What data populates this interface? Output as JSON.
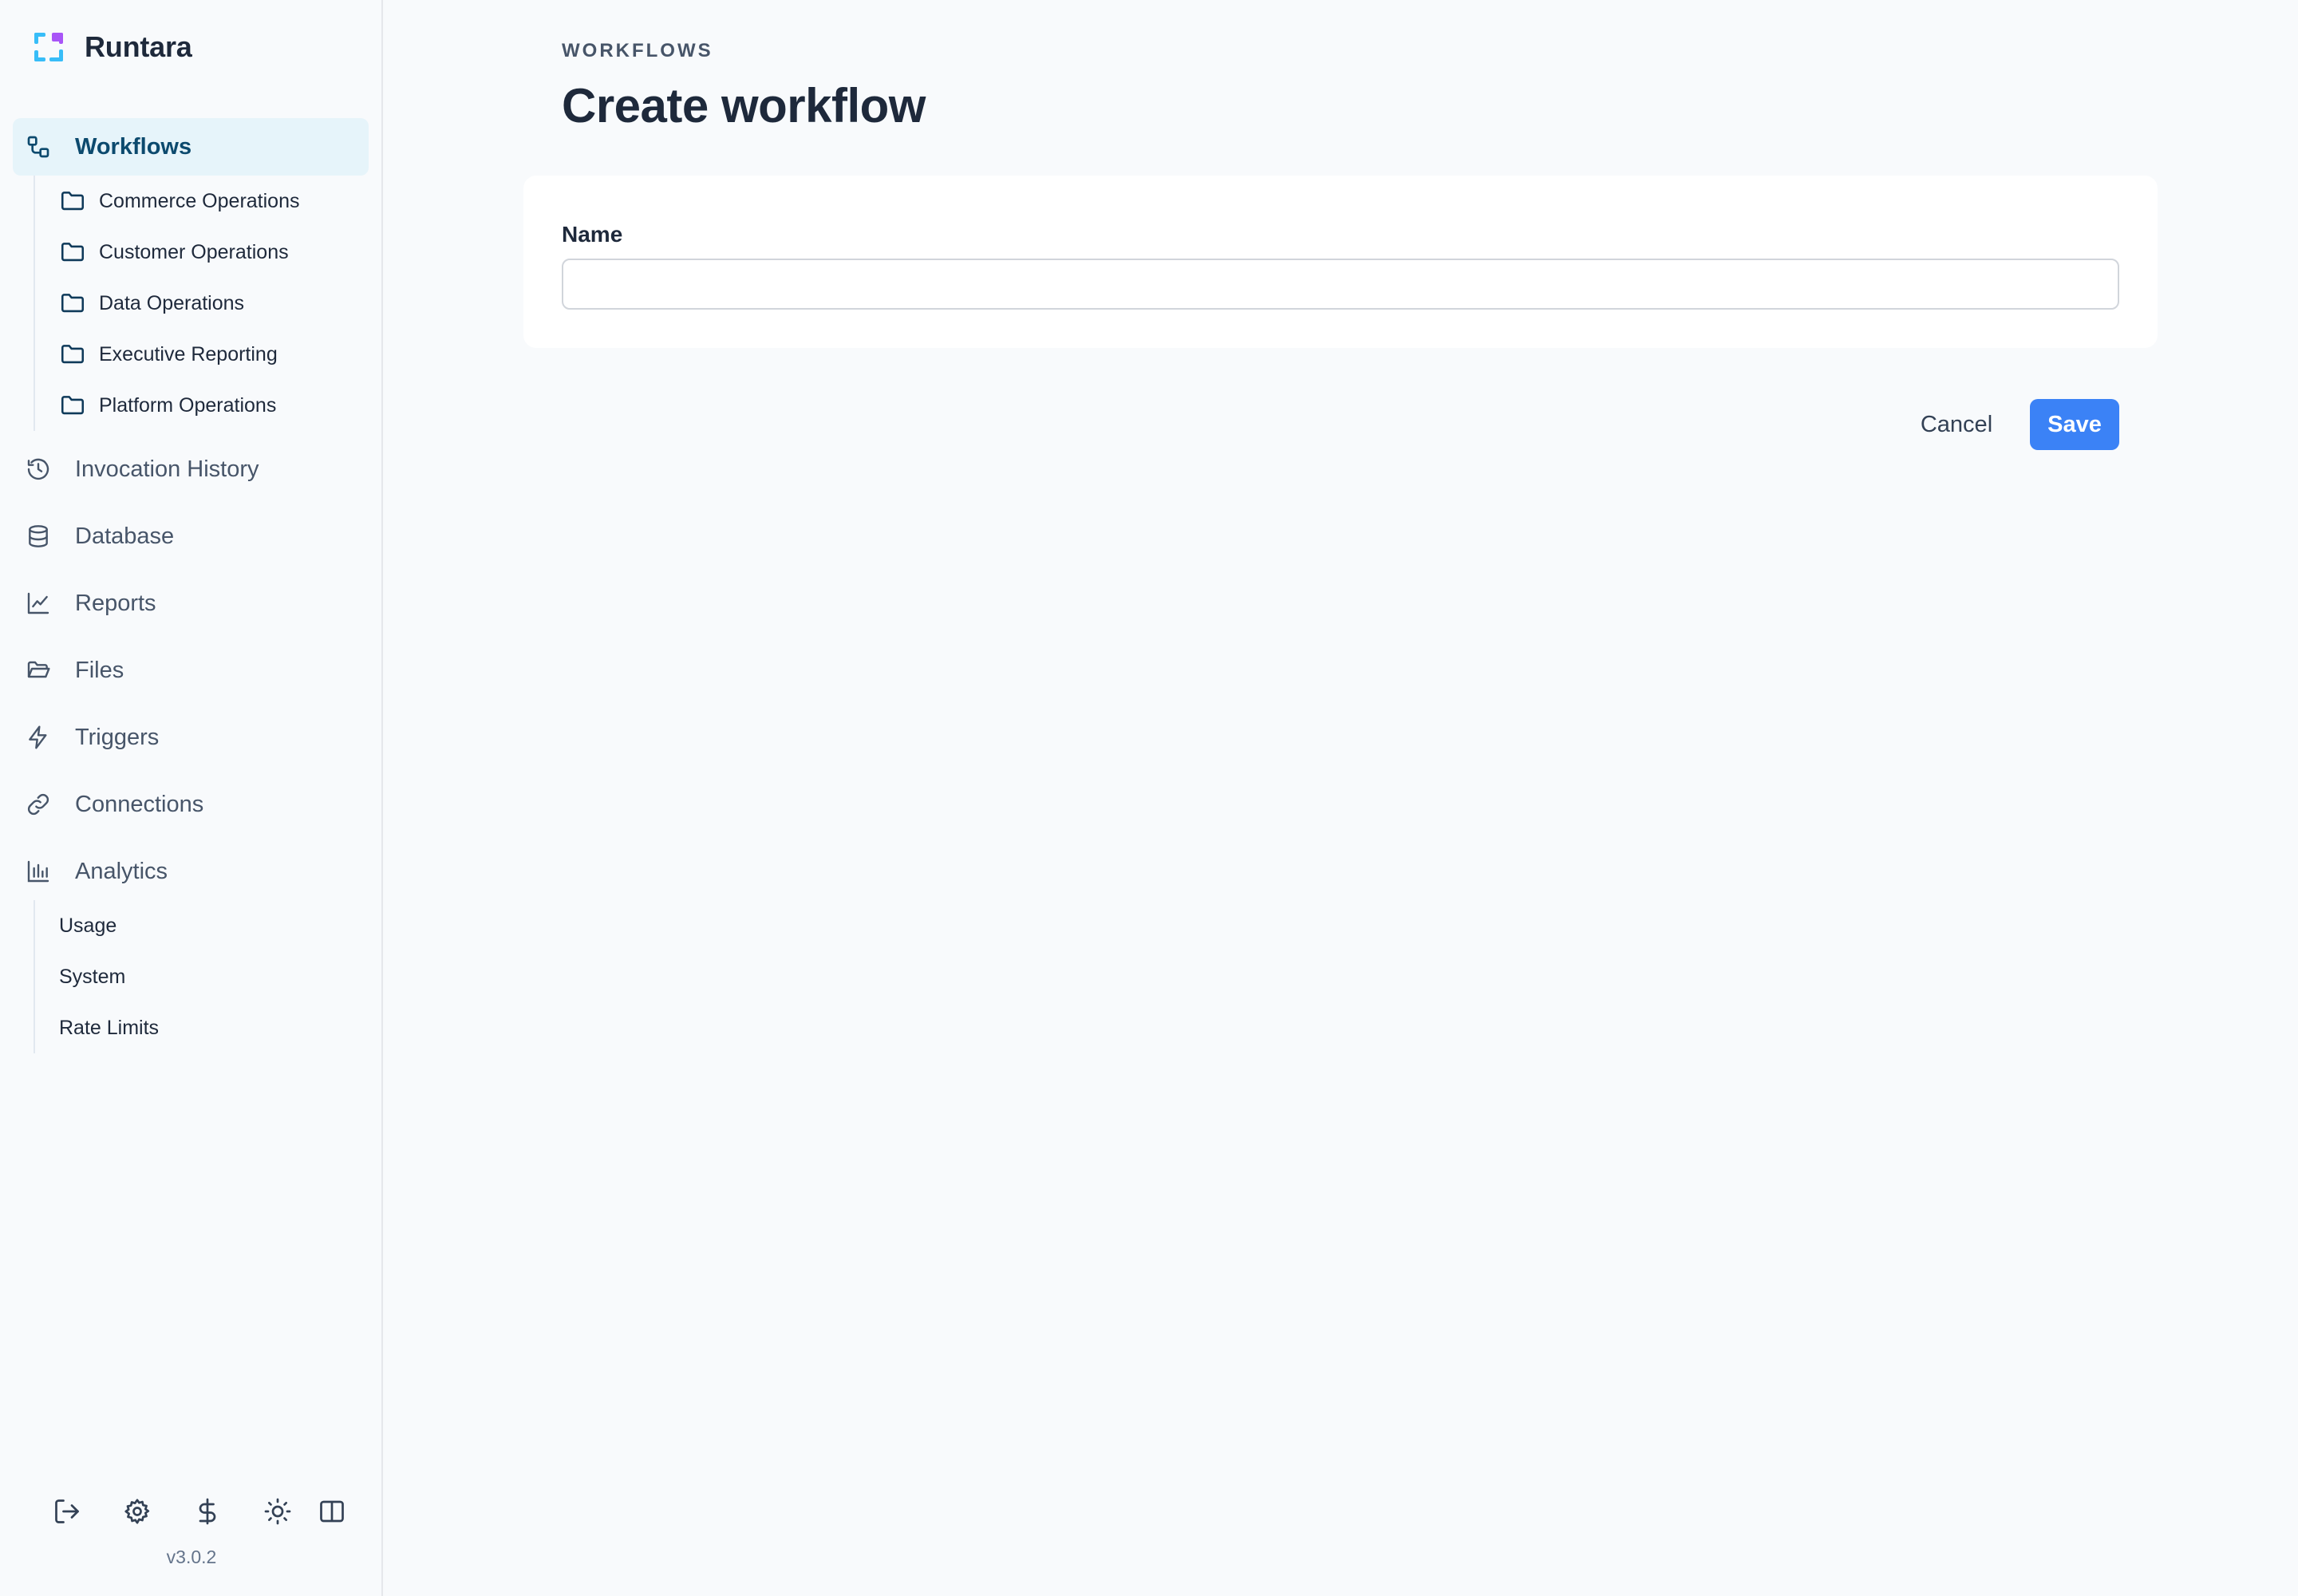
{
  "app": {
    "name": "Runtara",
    "version": "v3.0.2"
  },
  "sidebar": {
    "active": {
      "label": "Workflows",
      "icon": "workflow-icon"
    },
    "folders": [
      {
        "label": "Commerce Operations",
        "icon": "folder-icon"
      },
      {
        "label": "Customer Operations",
        "icon": "folder-icon"
      },
      {
        "label": "Data Operations",
        "icon": "folder-icon"
      },
      {
        "label": "Executive Reporting",
        "icon": "folder-icon"
      },
      {
        "label": "Platform Operations",
        "icon": "folder-icon"
      }
    ],
    "items": [
      {
        "label": "Invocation History",
        "icon": "history-icon"
      },
      {
        "label": "Database",
        "icon": "database-icon"
      },
      {
        "label": "Reports",
        "icon": "chart-line-icon"
      },
      {
        "label": "Files",
        "icon": "folder-open-icon"
      },
      {
        "label": "Triggers",
        "icon": "lightning-icon"
      },
      {
        "label": "Connections",
        "icon": "link-icon"
      },
      {
        "label": "Analytics",
        "icon": "bar-chart-icon"
      }
    ],
    "analytics_children": [
      {
        "label": "Usage"
      },
      {
        "label": "System"
      },
      {
        "label": "Rate Limits"
      }
    ],
    "footer_icons": [
      "logout-icon",
      "settings-icon",
      "dollar-icon",
      "theme-sun-icon",
      "layout-toggle-icon"
    ]
  },
  "page": {
    "breadcrumb": "WORKFLOWS",
    "title": "Create workflow"
  },
  "form": {
    "name_label": "Name",
    "name_value": "",
    "cancel_label": "Cancel",
    "save_label": "Save"
  },
  "colors": {
    "accent": "#3b82f6",
    "active_nav_bg": "#e6f4fa",
    "active_nav_text": "#0c4a6e",
    "page_bg": "#f8fafc"
  }
}
